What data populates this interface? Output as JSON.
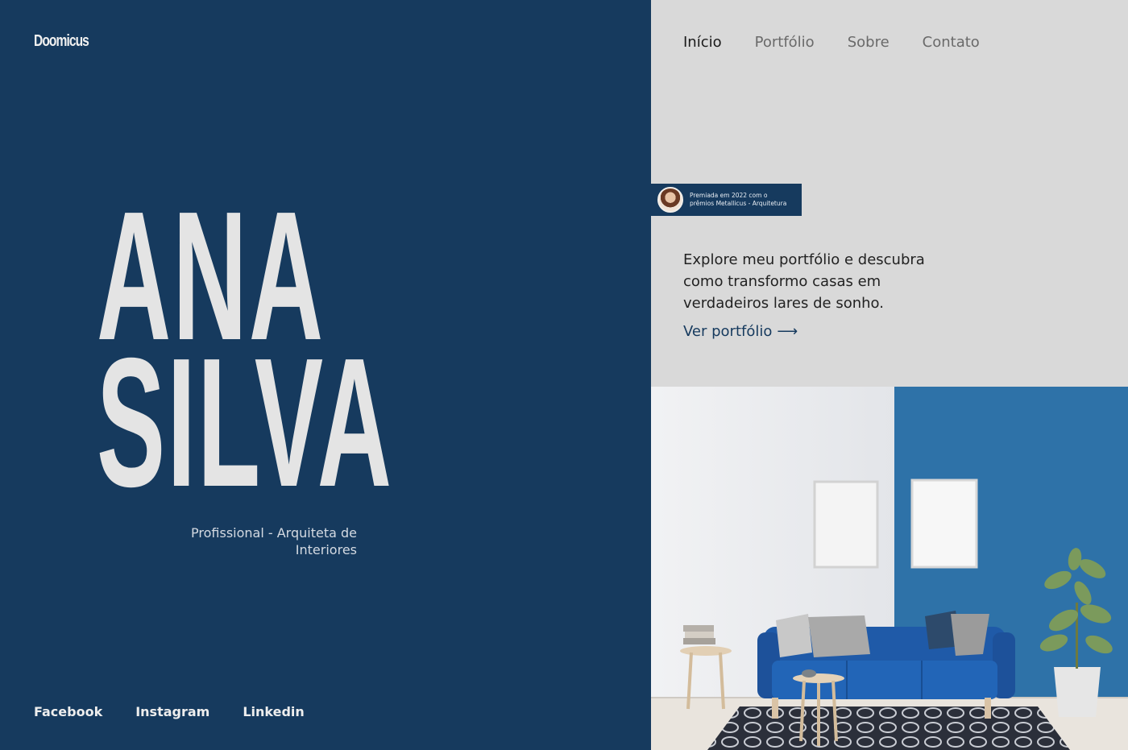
{
  "brand": {
    "logo": "Doomicus"
  },
  "hero": {
    "first_name": "ANA",
    "last_name": "SILVA",
    "tagline": "Profissional - Arquiteta de Interiores"
  },
  "social": [
    {
      "label": "Facebook"
    },
    {
      "label": "Instagram"
    },
    {
      "label": "Linkedin"
    }
  ],
  "nav": [
    {
      "label": "Início",
      "active": true
    },
    {
      "label": "Portfólio",
      "active": false
    },
    {
      "label": "Sobre",
      "active": false
    },
    {
      "label": "Contato",
      "active": false
    }
  ],
  "award": {
    "line1": "Premiada em 2022 com o",
    "line2": "prêmios Metallicus - Arquitetura"
  },
  "intro": {
    "text": "Explore meu portfólio e descubra como transformo casas em verdadeiros lares de sonho.",
    "cta_label": "Ver portfólio",
    "cta_arrow": "⟶"
  },
  "colors": {
    "primary": "#163a5e",
    "light_bg": "#d9d9d9",
    "hero_text": "#e4e4e4",
    "wall_blue": "#2e72a8",
    "sofa_blue": "#1f5aa8"
  }
}
